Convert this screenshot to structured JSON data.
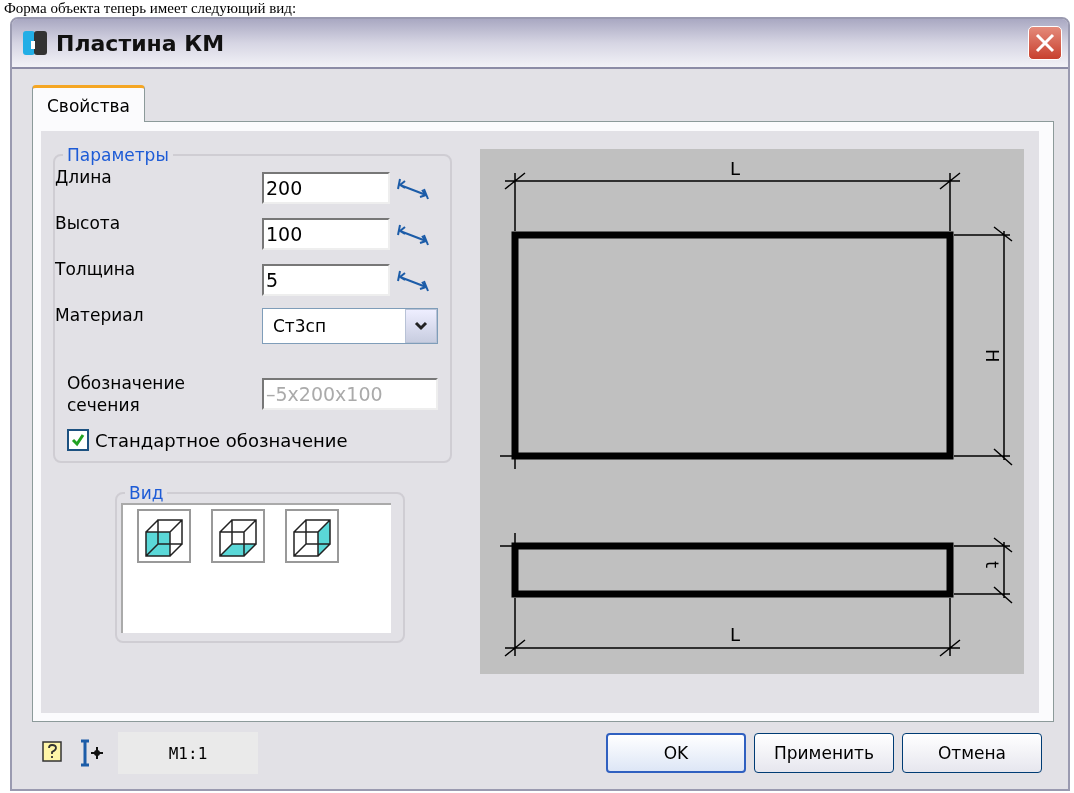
{
  "page_text": "Форма объекта теперь имеет следующий вид:",
  "window": {
    "title": "Пластина КМ"
  },
  "tabs": [
    {
      "label": "Свойства",
      "selected": true
    }
  ],
  "parameters": {
    "legend": "Параметры",
    "fields": [
      {
        "kind": "input",
        "label": "Длина",
        "value": "200"
      },
      {
        "kind": "input",
        "label": "Высота",
        "value": "100"
      },
      {
        "kind": "input",
        "label": "Толщина",
        "value": "5"
      },
      {
        "kind": "select",
        "label": "Материал",
        "value": "Ст3сп"
      }
    ],
    "designation": {
      "label": "Обозначение сечения",
      "value": "–5x200x100",
      "disabled": true
    },
    "standard": {
      "label": "Стандартное обозначение",
      "checked": true
    }
  },
  "view": {
    "legend": "Вид",
    "options": [
      {
        "kind": "front"
      },
      {
        "kind": "bottom"
      },
      {
        "kind": "side"
      }
    ]
  },
  "drawing": {
    "length_label": "L",
    "height_label": "H",
    "thickness_label": "t",
    "bottom_length_label": "L"
  },
  "footer": {
    "scale": "M1:1",
    "buttons": [
      {
        "label": "OK",
        "default": true
      },
      {
        "label": "Применить",
        "default": false
      },
      {
        "label": "Отмена",
        "default": false
      }
    ]
  }
}
